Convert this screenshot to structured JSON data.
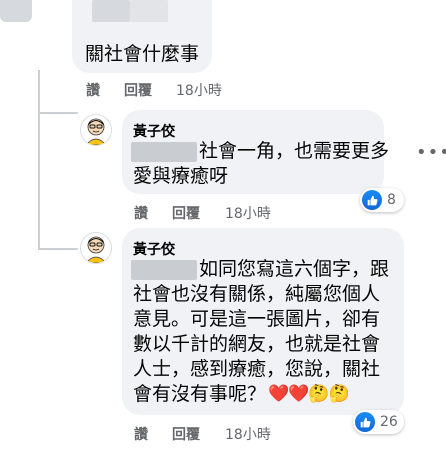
{
  "comment1": {
    "text": "關社會什麼事",
    "actions": {
      "like": "讚",
      "reply": "回覆",
      "time": "18小時"
    }
  },
  "reply1": {
    "author": "黃子佼",
    "line1": "社會一角，也需要更多",
    "line2": "愛與療癒呀",
    "reaction_count": "8",
    "actions": {
      "like": "讚",
      "reply": "回覆",
      "time": "18小時"
    }
  },
  "reply2": {
    "author": "黃子佼",
    "line1": "如同您寫這六個字，跟",
    "line2": "社會也沒有關係，純屬您個人",
    "line3": "意見。可是這一張圖片，卻有",
    "line4": "數以千計的網友，也就是社會",
    "line5": "人士，感到療癒，您說，關社",
    "line6": "會有沒有事呢？",
    "emojis": "❤️❤️🤔🤔",
    "reaction_count": "26",
    "actions": {
      "like": "讚",
      "reply": "回覆",
      "time": "18小時"
    }
  },
  "icons": {
    "like": "thumbs-up-icon",
    "more": "more-options-icon"
  },
  "colors": {
    "bubble": "#f0f2f5",
    "like_blue": "#1877f2",
    "meta_gray": "#65676b"
  }
}
